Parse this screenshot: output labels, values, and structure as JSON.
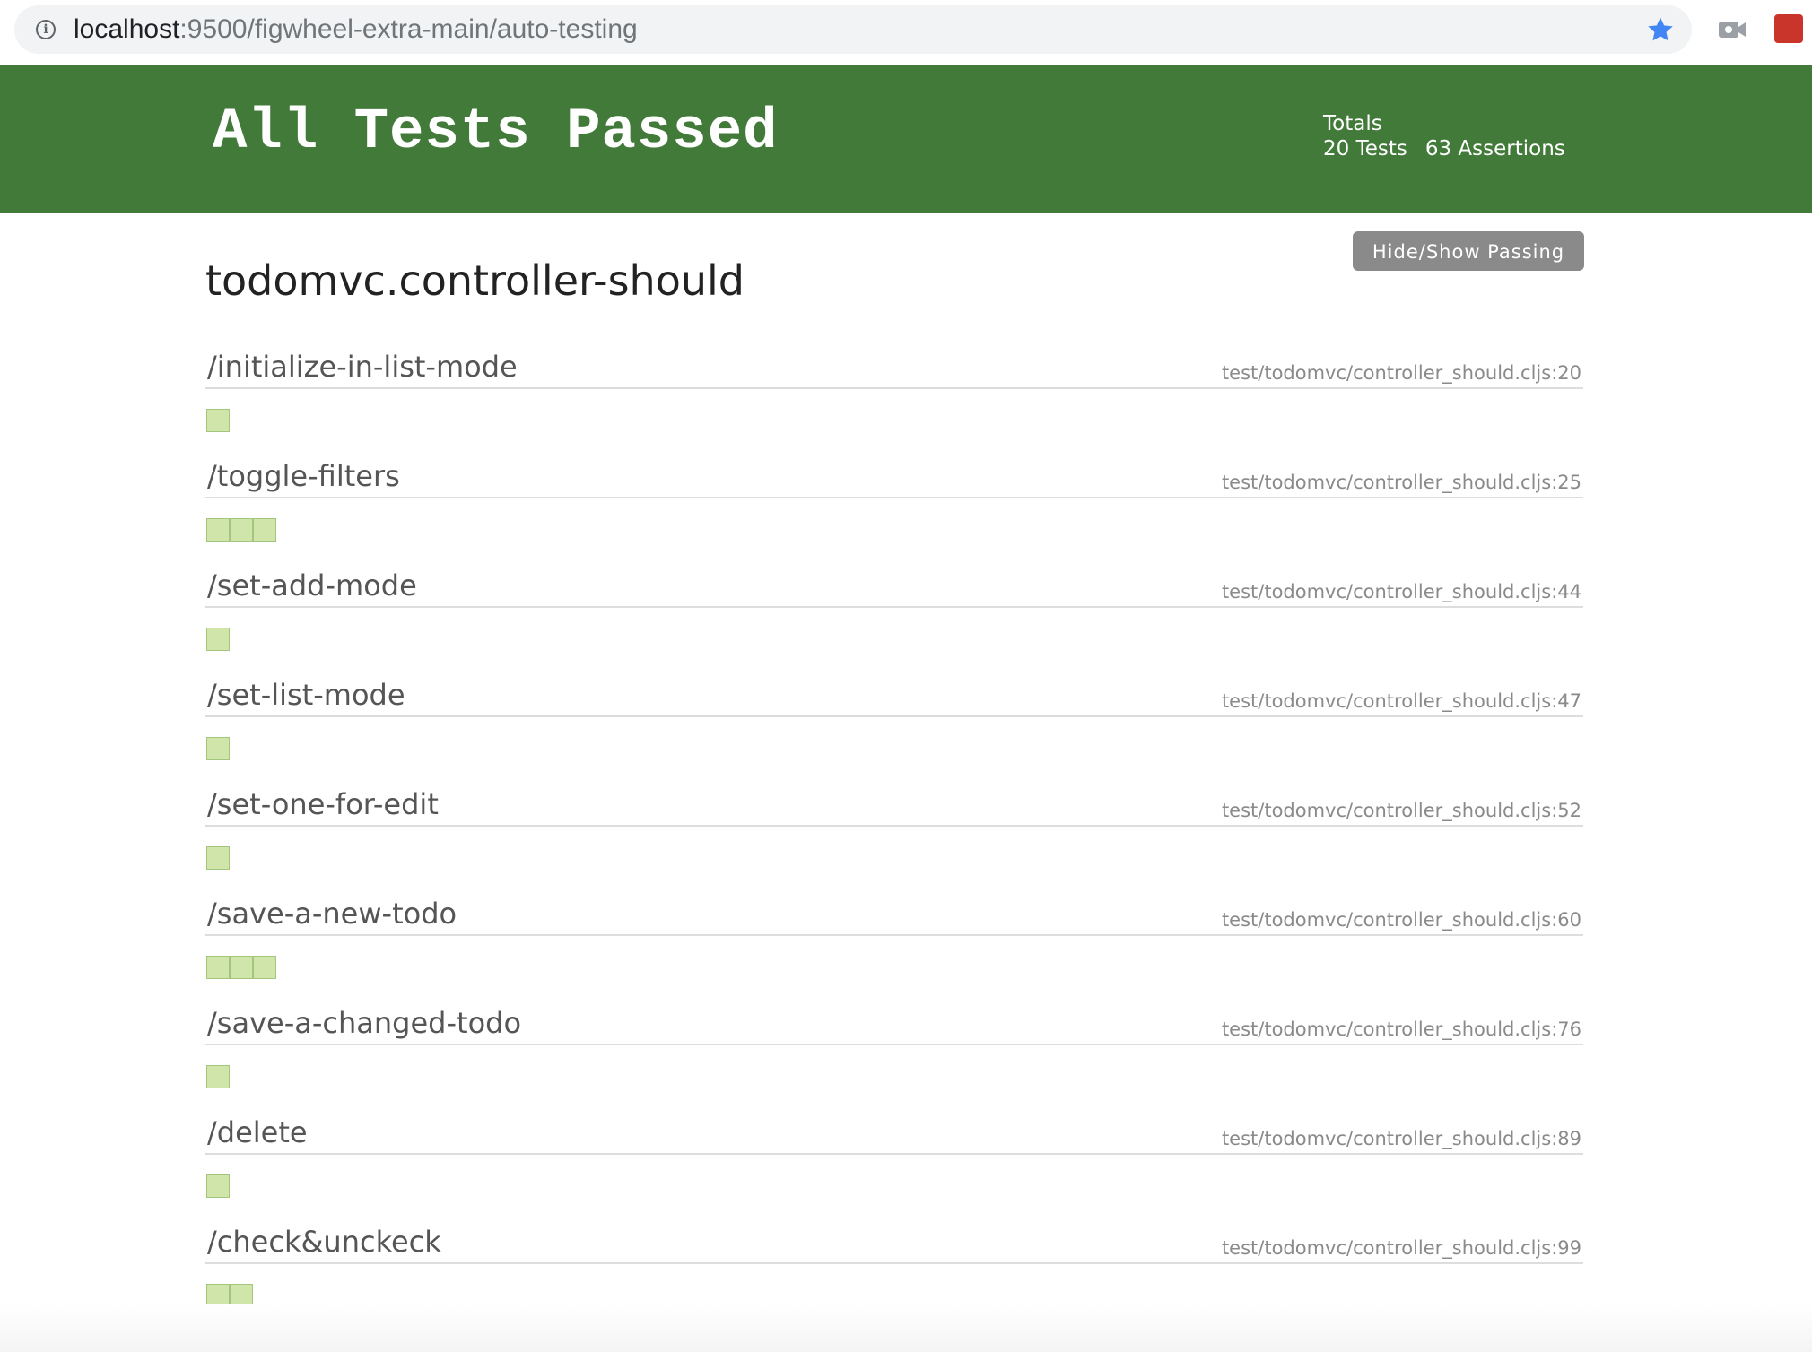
{
  "browser": {
    "url_host": "localhost",
    "url_rest": ":9500/figwheel-extra-main/auto-testing"
  },
  "colors": {
    "header_bg": "#427a39",
    "assertion_pass": "#cfe5aa",
    "button_bg": "#8a8a8a"
  },
  "header": {
    "title": "All Tests Passed",
    "totals_label": "Totals",
    "tests_count": "20 Tests",
    "assertions_count": "63 Assertions"
  },
  "controls": {
    "toggle_label": "Hide/Show Passing"
  },
  "namespace": {
    "name": "todomvc.controller-should",
    "tests": [
      {
        "name": "/initialize-in-list-mode",
        "file": "test/todomvc/controller_should.cljs:20",
        "assertions": 1
      },
      {
        "name": "/toggle-filters",
        "file": "test/todomvc/controller_should.cljs:25",
        "assertions": 3
      },
      {
        "name": "/set-add-mode",
        "file": "test/todomvc/controller_should.cljs:44",
        "assertions": 1
      },
      {
        "name": "/set-list-mode",
        "file": "test/todomvc/controller_should.cljs:47",
        "assertions": 1
      },
      {
        "name": "/set-one-for-edit",
        "file": "test/todomvc/controller_should.cljs:52",
        "assertions": 1
      },
      {
        "name": "/save-a-new-todo",
        "file": "test/todomvc/controller_should.cljs:60",
        "assertions": 3
      },
      {
        "name": "/save-a-changed-todo",
        "file": "test/todomvc/controller_should.cljs:76",
        "assertions": 1
      },
      {
        "name": "/delete",
        "file": "test/todomvc/controller_should.cljs:89",
        "assertions": 1
      },
      {
        "name": "/check&unckeck",
        "file": "test/todomvc/controller_should.cljs:99",
        "assertions": 2
      }
    ]
  }
}
